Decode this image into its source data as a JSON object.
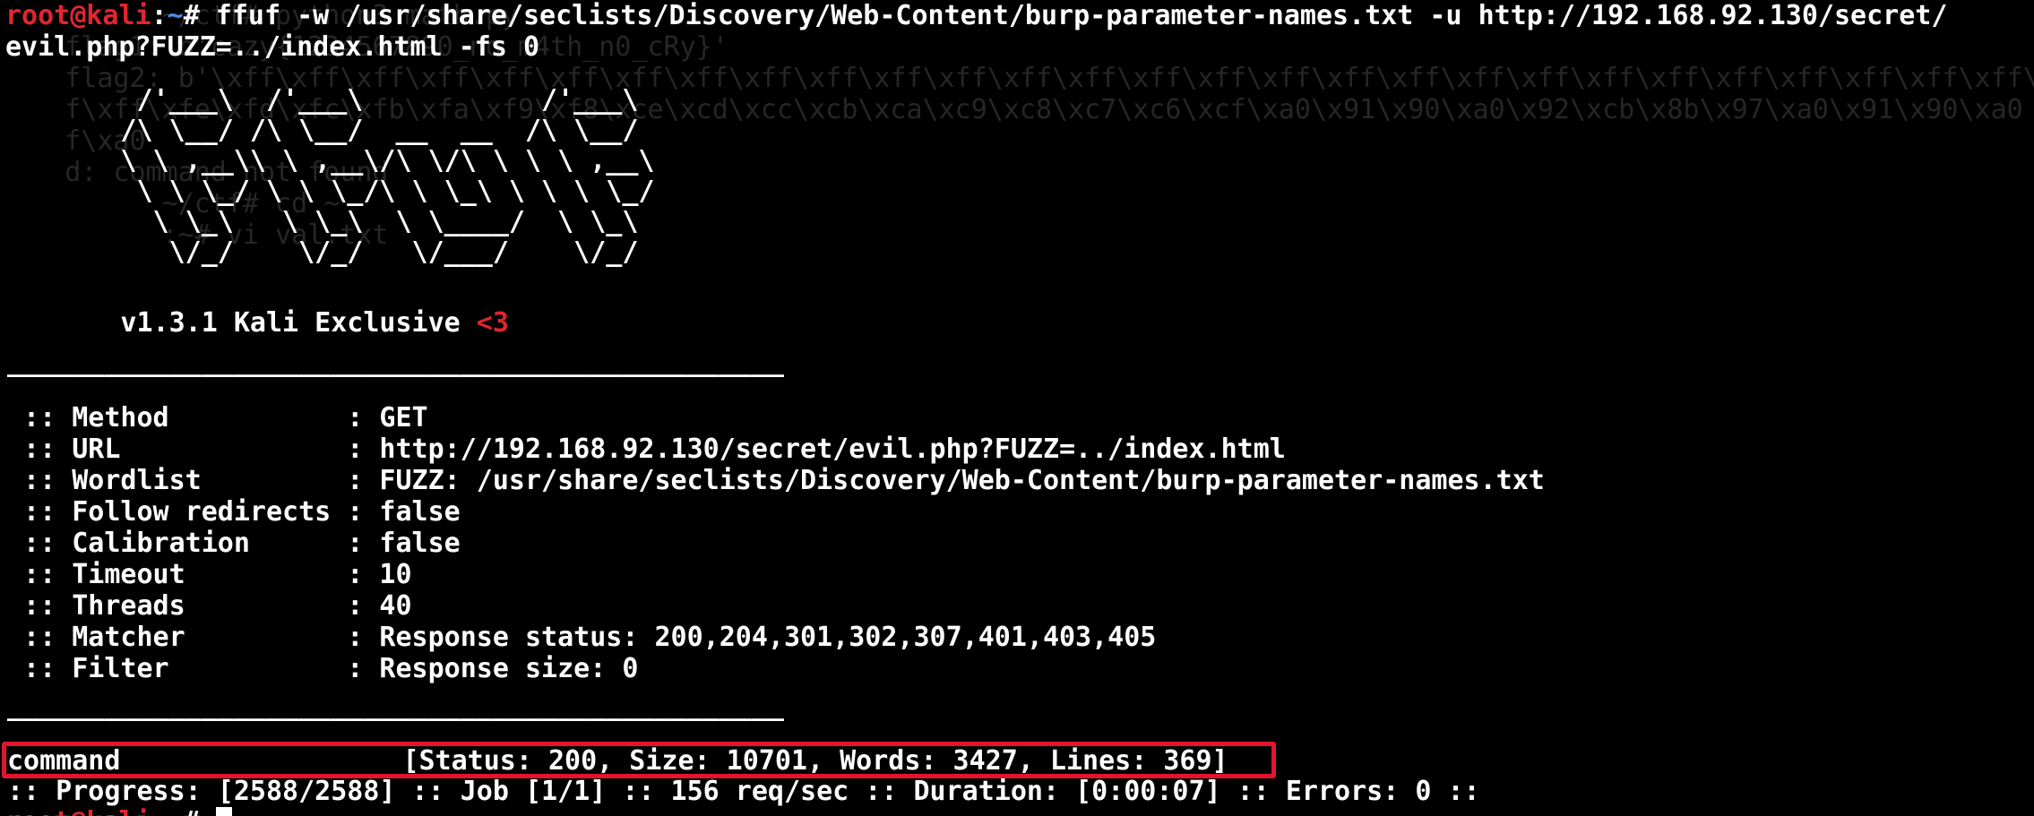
{
  "prompt": {
    "user_host": "root@kali",
    "path": "~",
    "symbol": "#"
  },
  "command_line_1": " ffuf -w /usr/share/seclists/Discovery/Web-Content/burp-parameter-names.txt -u http://192.168.92.130/secret/",
  "command_line_2": "evil.php?FUZZ=../index.html -fs 0",
  "banner": [
    "        /'___\\  /'___\\           /'___\\",
    "       /\\ \\__/ /\\ \\__/  __  __  /\\ \\__/",
    "       \\ \\ ,__\\\\ \\ ,__\\/\\ \\/\\ \\ \\ \\ ,__\\",
    "        \\ \\ \\_/ \\ \\ \\_/\\ \\ \\_\\ \\ \\ \\ \\_/",
    "         \\ \\_\\   \\ \\_\\  \\ \\____/  \\ \\_\\",
    "          \\/_/    \\/_/   \\/___/    \\/_/"
  ],
  "version": "       v1.3.1 Kali Exclusive ",
  "heart": "<3",
  "separator": "________________________________________________",
  "config": [
    " :: Method           : GET",
    " :: URL              : http://192.168.92.130/secret/evil.php?FUZZ=../index.html",
    " :: Wordlist         : FUZZ: /usr/share/seclists/Discovery/Web-Content/burp-parameter-names.txt",
    " :: Follow redirects : false",
    " :: Calibration      : false",
    " :: Timeout          : 10",
    " :: Threads          : 40",
    " :: Matcher          : Response status: 200,204,301,302,307,401,403,405",
    " :: Filter           : Response size: 0"
  ],
  "result": {
    "word": "command",
    "details": "[Status: 200, Size: 10701, Words: 3427, Lines: 369]"
  },
  "progress": ":: Progress: [2588/2588] :: Job [1/1] :: 156 req/sec :: Duration: [0:00:07] :: Errors: 0 ::",
  "background_ghost": [
    "",
    "          ~/ctf# python3 math.py",
    "    flag1: b'cazy{1234567890_no_m4th_n0_cRy}'",
    "    flag2: b'\\xff\\xff\\xff\\xff\\xff\\xff\\xff\\xff\\xff\\xff\\xff\\xff\\xff\\xff\\xff\\xff\\xff\\xff\\xff\\xff\\xff\\xff\\xff\\xff\\xff\\xff\\xff\\xff\\xff",
    "    f\\xff\\xfe\\xfd\\xfc\\xfb\\xfa\\xf9\\xf8\\xce\\xcd\\xcc\\xcb\\xca\\xc9\\xc8\\xc7\\xc6\\xcf\\xa0\\x91\\x90\\xa0\\x92\\xcb\\x8b\\x97\\xa0\\x91\\x90\\xa0",
    "    f\\xa0",
    "",
    "    d: command not found",
    "          ~/ctf# cd ~",
    "          :~# vi val.txt",
    ""
  ],
  "colors": {
    "background": "#000000",
    "prompt_user": "#e0262f",
    "prompt_path": "#4a8cf5",
    "text": "#ffffff",
    "highlight_border": "#e3152e",
    "ghost_text": "#262626"
  }
}
